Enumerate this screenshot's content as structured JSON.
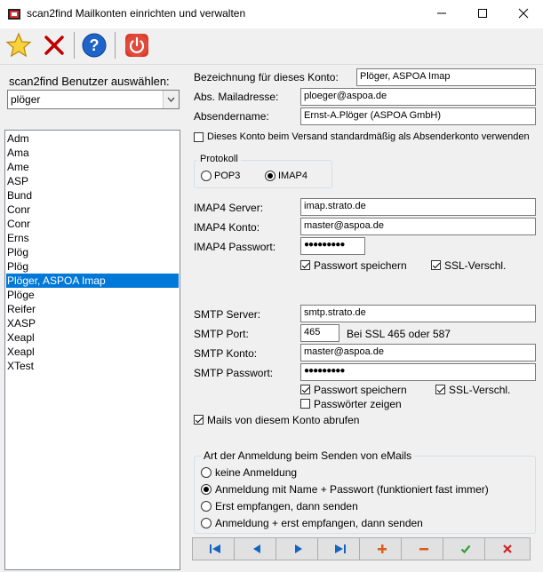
{
  "window": {
    "title": "scan2find Mailkonten einrichten und verwalten"
  },
  "toolbar": {
    "new_icon": "star-icon",
    "delete_icon": "x-icon",
    "help_icon": "help-icon",
    "exit_icon": "power-icon"
  },
  "user_select": {
    "label": "scan2find Benutzer auswählen:",
    "value": "plöger"
  },
  "accounts": [
    "Adm",
    "Ama",
    "Ame",
    "ASP",
    "Bund",
    "Conr",
    "Conr",
    "Erns",
    "Plög",
    "Plög",
    "Plöger, ASPOA Imap",
    "Plöge",
    "Reifer",
    "XASP",
    "Xeapl",
    "Xeapl",
    "XTest"
  ],
  "selected_account_index": 10,
  "form": {
    "bezeichnung_label": "Bezeichnung für dieses Konto:",
    "bezeichnung_value": "Plöger, ASPOA Imap",
    "mailadresse_label": "Abs. Mailadresse:",
    "mailadresse_value": "ploeger@aspoa.de",
    "absendername_label": "Absendername:",
    "absendername_value": "Ernst-A.Plöger (ASPOA GmbH)",
    "default_sender_label": "Dieses Konto beim Versand standardmäßig als Absenderkonto verwenden",
    "default_sender_checked": false,
    "protokoll_title": "Protokoll",
    "pop3_label": "POP3",
    "imap4_label": "IMAP4",
    "selected_protocol": "IMAP4",
    "imap_server_label": "IMAP4 Server:",
    "imap_server_value": "imap.strato.de",
    "imap_konto_label": "IMAP4 Konto:",
    "imap_konto_value": "master@aspoa.de",
    "imap_passwort_label": "IMAP4 Passwort:",
    "imap_passwort_value": "●●●●●●●●●",
    "imap_save_pw_label": "Passwort speichern",
    "imap_ssl_label": "SSL-Verschl.",
    "smtp_server_label": "SMTP Server:",
    "smtp_server_value": "smtp.strato.de",
    "smtp_port_label": "SMTP Port:",
    "smtp_port_value": "465",
    "smtp_port_hint": "Bei SSL 465 oder 587",
    "smtp_konto_label": "SMTP Konto:",
    "smtp_konto_value": "master@aspoa.de",
    "smtp_passwort_label": "SMTP Passwort:",
    "smtp_passwort_value": "●●●●●●●●●",
    "smtp_save_pw_label": "Passwort speichern",
    "smtp_ssl_label": "SSL-Verschl.",
    "show_pw_label": "Passwörter zeigen",
    "fetch_mail_label": "Mails von diesem Konto abrufen"
  },
  "auth": {
    "title": "Art der Anmeldung beim Senden von eMails",
    "options": [
      "keine Anmeldung",
      "Anmeldung mit Name + Passwort (funktioniert fast immer)",
      "Erst empfangen, dann senden",
      "Anmeldung + erst empfangen, dann senden"
    ],
    "selected_index": 1
  },
  "nav_buttons": {
    "first": "first-record-icon",
    "prev": "prev-record-icon",
    "next": "next-record-icon",
    "last": "last-record-icon",
    "add": "plus-icon",
    "remove": "minus-icon",
    "confirm": "check-icon",
    "cancel": "cancel-icon"
  },
  "colors": {
    "selection": "#0078d7",
    "delete_red": "#c00000",
    "help_blue": "#1e64c8",
    "power_red": "#d93a2b",
    "nav_blue": "#1565c0",
    "ok_green": "#2e9e3a"
  }
}
